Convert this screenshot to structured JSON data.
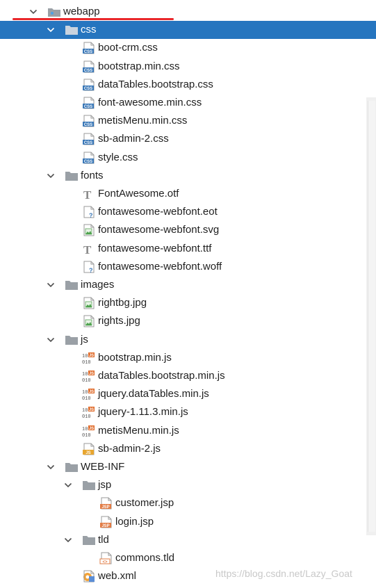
{
  "colors": {
    "selection": "#2675bf",
    "folder": "#9aa0a6",
    "css_badge": "#3a78b8",
    "js_badge": "#e06b2a",
    "jsp_badge": "#e27c45",
    "underline": "#e8262b"
  },
  "tree": [
    {
      "label": "webapp",
      "kind": "folder-web",
      "depth": 0,
      "expanded": true
    },
    {
      "label": "css",
      "kind": "folder",
      "depth": 1,
      "expanded": true,
      "selected": true
    },
    {
      "label": "boot-crm.css",
      "kind": "css",
      "depth": 2
    },
    {
      "label": "bootstrap.min.css",
      "kind": "css",
      "depth": 2
    },
    {
      "label": "dataTables.bootstrap.css",
      "kind": "css",
      "depth": 2
    },
    {
      "label": "font-awesome.min.css",
      "kind": "css",
      "depth": 2
    },
    {
      "label": "metisMenu.min.css",
      "kind": "css",
      "depth": 2
    },
    {
      "label": "sb-admin-2.css",
      "kind": "css",
      "depth": 2
    },
    {
      "label": "style.css",
      "kind": "css",
      "depth": 2
    },
    {
      "label": "fonts",
      "kind": "folder",
      "depth": 1,
      "expanded": true
    },
    {
      "label": "FontAwesome.otf",
      "kind": "font",
      "depth": 2
    },
    {
      "label": "fontawesome-webfont.eot",
      "kind": "unknown",
      "depth": 2
    },
    {
      "label": "fontawesome-webfont.svg",
      "kind": "image",
      "depth": 2
    },
    {
      "label": "fontawesome-webfont.ttf",
      "kind": "font",
      "depth": 2
    },
    {
      "label": "fontawesome-webfont.woff",
      "kind": "unknown",
      "depth": 2
    },
    {
      "label": "images",
      "kind": "folder",
      "depth": 1,
      "expanded": true
    },
    {
      "label": "rightbg.jpg",
      "kind": "image",
      "depth": 2
    },
    {
      "label": "rights.jpg",
      "kind": "image",
      "depth": 2
    },
    {
      "label": "js",
      "kind": "folder",
      "depth": 1,
      "expanded": true
    },
    {
      "label": "bootstrap.min.js",
      "kind": "minjs",
      "depth": 2
    },
    {
      "label": "dataTables.bootstrap.min.js",
      "kind": "minjs",
      "depth": 2
    },
    {
      "label": "jquery.dataTables.min.js",
      "kind": "minjs",
      "depth": 2
    },
    {
      "label": "jquery-1.11.3.min.js",
      "kind": "minjs",
      "depth": 2
    },
    {
      "label": "metisMenu.min.js",
      "kind": "minjs",
      "depth": 2
    },
    {
      "label": "sb-admin-2.js",
      "kind": "js",
      "depth": 2
    },
    {
      "label": "WEB-INF",
      "kind": "folder",
      "depth": 1,
      "expanded": true
    },
    {
      "label": "jsp",
      "kind": "folder",
      "depth": 2,
      "expanded": true
    },
    {
      "label": "customer.jsp",
      "kind": "jsp",
      "depth": 3
    },
    {
      "label": "login.jsp",
      "kind": "jsp",
      "depth": 3
    },
    {
      "label": "tld",
      "kind": "folder",
      "depth": 2,
      "expanded": true
    },
    {
      "label": "commons.tld",
      "kind": "tld",
      "depth": 3
    },
    {
      "label": "web.xml",
      "kind": "xml",
      "depth": 2
    }
  ],
  "watermark": "https://blog.csdn.net/Lazy_Goat"
}
